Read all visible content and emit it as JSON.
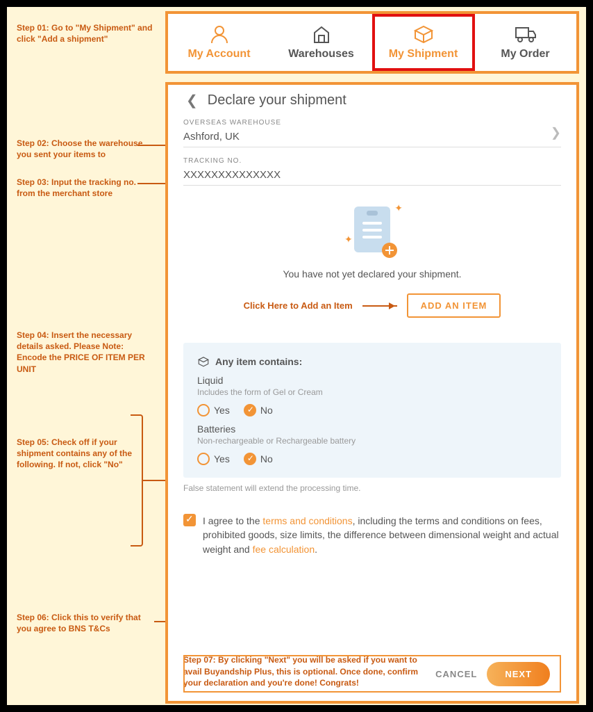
{
  "steps": {
    "s1": "Step 01: Go to \"My Shipment\" and click \"Add a shipment\"",
    "s2": "Step 02: Choose the warehouse you sent your items to",
    "s3": "Step 03: Input the tracking no. from the merchant store",
    "s4": "Step 04: Insert the necessary details asked. Please Note: Encode the PRICE OF ITEM PER UNIT",
    "s5": "Step 05: Check off if your shipment contains any of the following. If not, click \"No\"",
    "s6": "Step 06: Click this to verify that you agree to BNS T&Cs",
    "s7": "Step 07: By clicking \"Next\" you will be asked if you want to avail Buyandship Plus, this is optional. Once done, confirm your declaration and you're done! Congrats!"
  },
  "nav": {
    "account": "My Account",
    "warehouses": "Warehouses",
    "shipment": "My Shipment",
    "order": "My Order"
  },
  "page": {
    "title": "Declare your shipment",
    "warehouse_label": "OVERSEAS WAREHOUSE",
    "warehouse_value": "Ashford, UK",
    "tracking_label": "TRACKING NO.",
    "tracking_value": "XXXXXXXXXXXXXX",
    "empty_text": "You have not yet declared your shipment.",
    "click_here_label": "Click Here to Add an Item",
    "add_item_btn": "ADD AN ITEM"
  },
  "card": {
    "heading": "Any item contains:",
    "liquid_label": "Liquid",
    "liquid_desc": "Includes the form of Gel or Cream",
    "batt_label": "Batteries",
    "batt_desc": "Non-rechargeable or Rechargeable battery",
    "yes": "Yes",
    "no": "No",
    "note": "False statement will extend the processing time."
  },
  "agree": {
    "prefix": "I agree to the ",
    "link1": "terms and conditions",
    "middle": ", including the terms and conditions on fees, prohibited goods, size limits, the difference between dimensional weight and actual weight and ",
    "link2": "fee calculation",
    "suffix": "."
  },
  "footer": {
    "cancel": "CANCEL",
    "next": "NEXT"
  }
}
